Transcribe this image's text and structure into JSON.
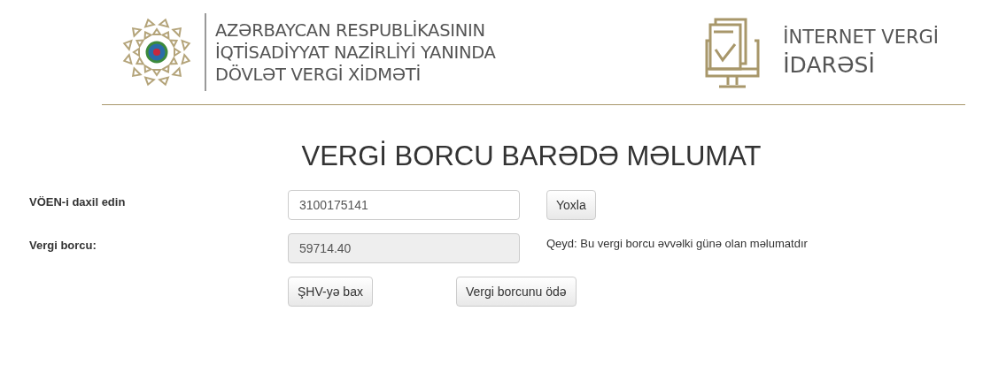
{
  "header": {
    "org_lines": [
      "AZƏRBAYCAN RESPUBLİKASININ",
      "İQTİSADİYYAT NAZİRLİYİ YANINDA",
      "DÖVLƏT VERGİ XİDMƏTİ"
    ],
    "service_lines": [
      "İNTERNET VERGİ",
      "İDARƏSİ"
    ]
  },
  "title": "VERGİ BORCU BARƏDƏ MƏLUMAT",
  "fields": [
    {
      "label": "VÖEN-i daxil edin",
      "value": "3100175141",
      "disabled": false,
      "button": "Yoxla"
    },
    {
      "label": "Vergi borcu:",
      "value": "59714.40",
      "disabled": true,
      "note": "Qeyd: Bu vergi borcu əvvəlki günə olan məlumatdır"
    }
  ],
  "actions": [
    "ŞHV-yə bax",
    "Vergi borcunu ödə"
  ]
}
